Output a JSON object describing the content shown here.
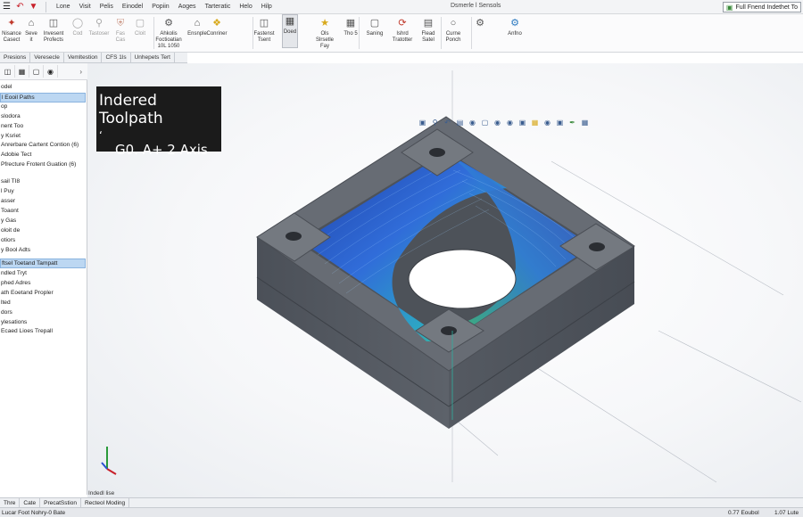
{
  "menubar": {
    "items": [
      "Lone",
      "Visit",
      "Pelis",
      "Einodel",
      "Popiin",
      "Aoges",
      "Tarteratic",
      "Helo",
      "Hilp"
    ],
    "doc_title": "Dsmerle l Sensols",
    "right_box": "Full Fnend Indethet To"
  },
  "ribbon": {
    "buttons": [
      {
        "label": "Nisance\nCasect"
      },
      {
        "label": "Seve\nit"
      },
      {
        "label": "Invesent\nProfects"
      },
      {
        "label": "Cod"
      },
      {
        "label": "Tastoser"
      },
      {
        "label": "Fas\nCas"
      },
      {
        "label": "Cloit"
      },
      {
        "label": "Ahkolis\nFoctioatian\n10L 1050"
      },
      {
        "label": "Ensnple"
      },
      {
        "label": "Conriner"
      },
      {
        "label": "Fastenst\nTsent"
      },
      {
        "label": "Doed"
      },
      {
        "label": "Ols\nSlrsetle\nFay"
      },
      {
        "label": "Tho 5"
      },
      {
        "label": "Saning"
      },
      {
        "label": "Ishrd\nTratotter"
      },
      {
        "label": "Flead\nSatel"
      },
      {
        "label": "Curne\nPonch"
      },
      {
        "label": "Anfno"
      }
    ]
  },
  "panel": {
    "tabs": [
      "Presions",
      "Veresecle",
      "Vemltestion",
      "CFS 1ls",
      "Unhepets Tert"
    ],
    "tree_items": [
      "odel",
      "l Eooil Paths",
      "op",
      "slodora",
      "nent Too",
      "y Ksriet",
      "Anrerbare Cartent Contion (6)",
      "Adobie Tect",
      "Pfrecture Frotent Guation (6)",
      "",
      "sail TI8",
      "l Puy",
      "asser",
      "Toaont",
      "y Gas",
      "oloit de",
      "otiors",
      "y Bool Adts",
      "",
      "ftsel Toetand Tampatt",
      "ndled Tryt",
      "phed Adres",
      "ath Eoetand Propler",
      "lted",
      "dors",
      "ylesations",
      "Ecaed Lioes Trepall"
    ],
    "selected_indices": [
      1,
      19
    ],
    "footer": "Indedl lise"
  },
  "viewport": {
    "overlay_title": "Indered Toolpath",
    "overlay_mark": "‘",
    "overlay_sub": "G0. A+ 2 Axis"
  },
  "bottom_tabs": [
    "Thre",
    "Cate",
    "PrecatSstion",
    "Recteol Moding"
  ],
  "status": {
    "left": "Lucar Foot Nohry-0 Bate",
    "right1": "0.77 Eoubol",
    "right2": "1.07 Lute"
  },
  "colors": {
    "accent": "#bcd7f2",
    "part": "#5b6068",
    "toolpath_blue": "#2a5fd0",
    "toolpath_green": "#3fbf6a"
  }
}
